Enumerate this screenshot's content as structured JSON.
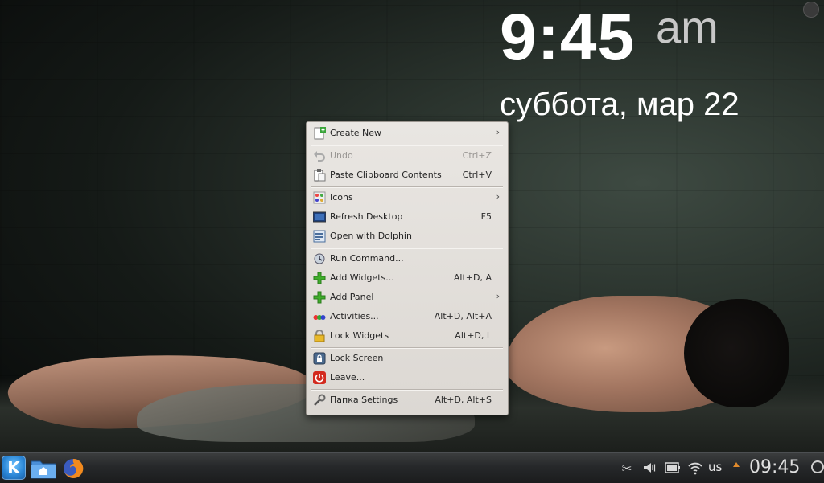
{
  "desktop": {
    "clock": {
      "time": "9:45",
      "ampm": "am",
      "date": "суббота, мар 22"
    }
  },
  "context_menu": {
    "items": [
      {
        "label": "Create New",
        "shortcut": "",
        "submenu": true,
        "icon": "document-new-icon"
      },
      {
        "label": "Undo",
        "shortcut": "Ctrl+Z",
        "disabled": true,
        "icon": "undo-icon"
      },
      {
        "label": "Paste Clipboard Contents",
        "shortcut": "Ctrl+V",
        "icon": "paste-icon"
      },
      {
        "label": "Icons",
        "shortcut": "",
        "submenu": true,
        "icon": "icons-icon"
      },
      {
        "label": "Refresh Desktop",
        "shortcut": "F5",
        "icon": "refresh-desktop-icon"
      },
      {
        "label": "Open with Dolphin",
        "shortcut": "",
        "icon": "dolphin-icon"
      },
      {
        "label": "Run Command...",
        "shortcut": "",
        "icon": "run-command-icon"
      },
      {
        "label": "Add Widgets...",
        "shortcut": "Alt+D, A",
        "icon": "add-icon"
      },
      {
        "label": "Add Panel",
        "shortcut": "",
        "submenu": true,
        "icon": "add-icon"
      },
      {
        "label": "Activities...",
        "shortcut": "Alt+D, Alt+A",
        "icon": "activities-icon"
      },
      {
        "label": "Lock Widgets",
        "shortcut": "Alt+D, L",
        "icon": "lock-icon"
      },
      {
        "label": "Lock Screen",
        "shortcut": "",
        "icon": "lock-screen-icon"
      },
      {
        "label": "Leave...",
        "shortcut": "",
        "icon": "power-icon"
      },
      {
        "label": "Папка Settings",
        "shortcut": "Alt+D, Alt+S",
        "icon": "settings-icon"
      }
    ],
    "arrow_glyph": "›"
  },
  "panel": {
    "launcher_glyph": "K",
    "tray": {
      "keyboard_layout": "us",
      "clock": "09:45"
    }
  }
}
